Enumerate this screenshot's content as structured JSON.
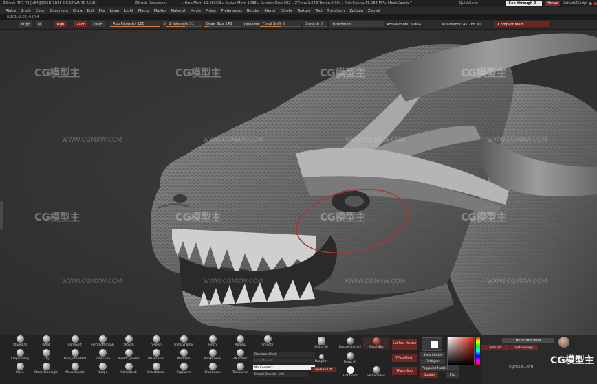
{
  "titlebar": {
    "title": "ZBrush 4R7 P3 [x64][3D6D-1R3F-QG3Z-WN4D-NA3I]",
    "document": "ZBrush Document",
    "memory": "▸ Free Mem 19.483GB ▸ Active Mem 1288 ▸ Scratch Disk 982 ▸ ZTime▸1.048 Timer▸0.001 ▸ PolyCount▸41.284 MP ▸ MeshCount▸7",
    "quick": "Quicl",
    "quicksave": "QuickSave",
    "seethrough": "See-through",
    "seethrough_value": "0",
    "menus": "Menus",
    "default_zscript": "DefaultZScript"
  },
  "menubar": {
    "items": [
      "Alpha",
      "Brush",
      "Color",
      "Document",
      "Draw",
      "Edit",
      "File",
      "Layer",
      "Light",
      "Macro",
      "Marker",
      "Material",
      "Movie",
      "Picker",
      "Preferences",
      "Render",
      "Stencil",
      "Stroke",
      "Texture",
      "Tool",
      "Transform",
      "Zplugin",
      "Zscript"
    ]
  },
  "coords": "0.281,-2.82,-0.874",
  "toolbar": {
    "mrgb": "Mrgb",
    "m": "M",
    "rgb": "Rgb",
    "zadd": "Zadd",
    "zsub": "Zsub",
    "rgb_intensity": "Rgb Intensity 100",
    "rgb_intensity_value": 1.0,
    "z": "Z",
    "z_intensity": "Z Intensity 51",
    "z_intensity_value": 0.51,
    "draw_size": "Draw Size 148",
    "draw_size_value": 0.148,
    "dynamic": "Dynamic",
    "focal_shift": "Focal Shift 0",
    "focal_shift_value": 0.5,
    "smooth": "Smooth 0",
    "brush_name": "BrushMod",
    "active_points": "ActivePoints: 6,084",
    "total_points": "TotalPoints: 41.288 Mil",
    "compact": "Compact Mem"
  },
  "viewport": {
    "watermark": "CG模型主",
    "watermark_url": "WWW.CGMXW.COM"
  },
  "shelf": {
    "brushes_row1": [
      "Standard",
      "Inflat",
      "FormSoft",
      "FormSoftRnsab",
      "zPolish",
      "hPolish",
      "TrimDynamic",
      "Pinch",
      "MorphL",
      "Smooth"
    ],
    "brushes_row2": [
      "ClayBuildup",
      "Clay",
      "Dam_Standard",
      "TrimCurve",
      "InsertCylinder",
      "MaskLasso",
      "MaskPen",
      "MaskCurve",
      "ZModeler"
    ],
    "brushes_row3": [
      "Move",
      "Move Topologic",
      "Move Elastic",
      "Nudge",
      "SelectRect",
      "SelectLasso",
      "ClipCurve",
      "SliceCurve",
      "TrimCurve"
    ],
    "backfacemask": "BackfaceMask",
    "lazymouse": "LazyMouse",
    "no_connect": "No Connect",
    "model_opacity": "Model Opacity 100",
    "alpha_label": "Alpha 58",
    "dragdot": "DragDot",
    "texture_off": "Texture Off",
    "basic_material": "BasicMaterial2",
    "metal": "Metal 01",
    "flat_color": "Flat Color",
    "skinshade": "SkinShade4",
    "metal_sbs": "Metal 8bs",
    "subtool_master": "SubTool Master",
    "tposemesh": "TPoseMesh",
    "tpose_sub": "TPose Sub",
    "switchcolor": "SwitchColor",
    "fillobject": "FillObject",
    "polypaint_mode": "Polypaint Mode 1",
    "double": "Double",
    "flip": "Flip",
    "mirror_weld": "Mirror And Weld",
    "rebuild": "Rebuild",
    "retopo": "Retopology",
    "logo": "CG模型主",
    "logo_url": "cgmxw.com"
  },
  "colors": {
    "accent_red": "#7b2620",
    "slider_orange": "#d57d2f",
    "viewport_bg": "#353535"
  }
}
